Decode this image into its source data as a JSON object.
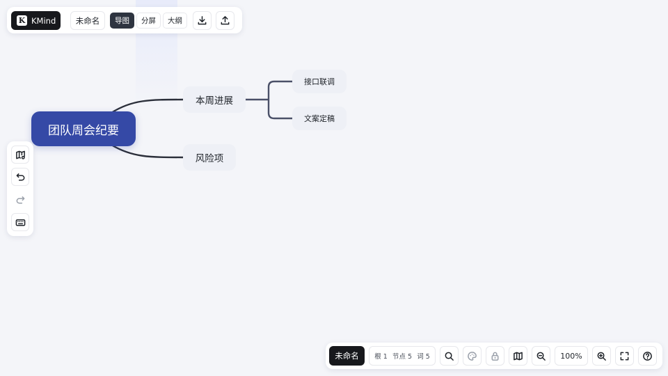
{
  "toolbar": {
    "brand_letter": "K",
    "brand_name": "KMind",
    "doc_name": "未命名",
    "view_modes": [
      "导图",
      "分屏",
      "大纲"
    ],
    "active_view": "导图",
    "icons": [
      "download-icon",
      "upload-icon"
    ]
  },
  "left_tools": {
    "icons": [
      "map-settings-icon",
      "undo-icon",
      "redo-icon",
      "keyboard-icon"
    ],
    "redo_disabled": true
  },
  "mindmap": {
    "root": "团队周会纪要",
    "topics": [
      {
        "label": "本周进展",
        "children": [
          "接口联调",
          "文案定稿"
        ]
      },
      {
        "label": "风险项",
        "children": []
      }
    ]
  },
  "statusbar": {
    "doc_name": "未命名",
    "stats": {
      "roots": "根 1",
      "nodes": "节点 5",
      "words": "词 5"
    },
    "zoom": "100%",
    "icons": [
      "search-icon",
      "theme-icon",
      "lock-icon",
      "map-icon",
      "zoom-out-icon",
      "zoom-in-icon",
      "fullscreen-icon",
      "help-icon"
    ]
  },
  "colors": {
    "root_fill": "#3549a6",
    "topic_fill": "#eef0f6",
    "link_stroke": "#2b2f3a",
    "branch_stroke": "#4a5068",
    "canvas": "#f4f5f9"
  }
}
